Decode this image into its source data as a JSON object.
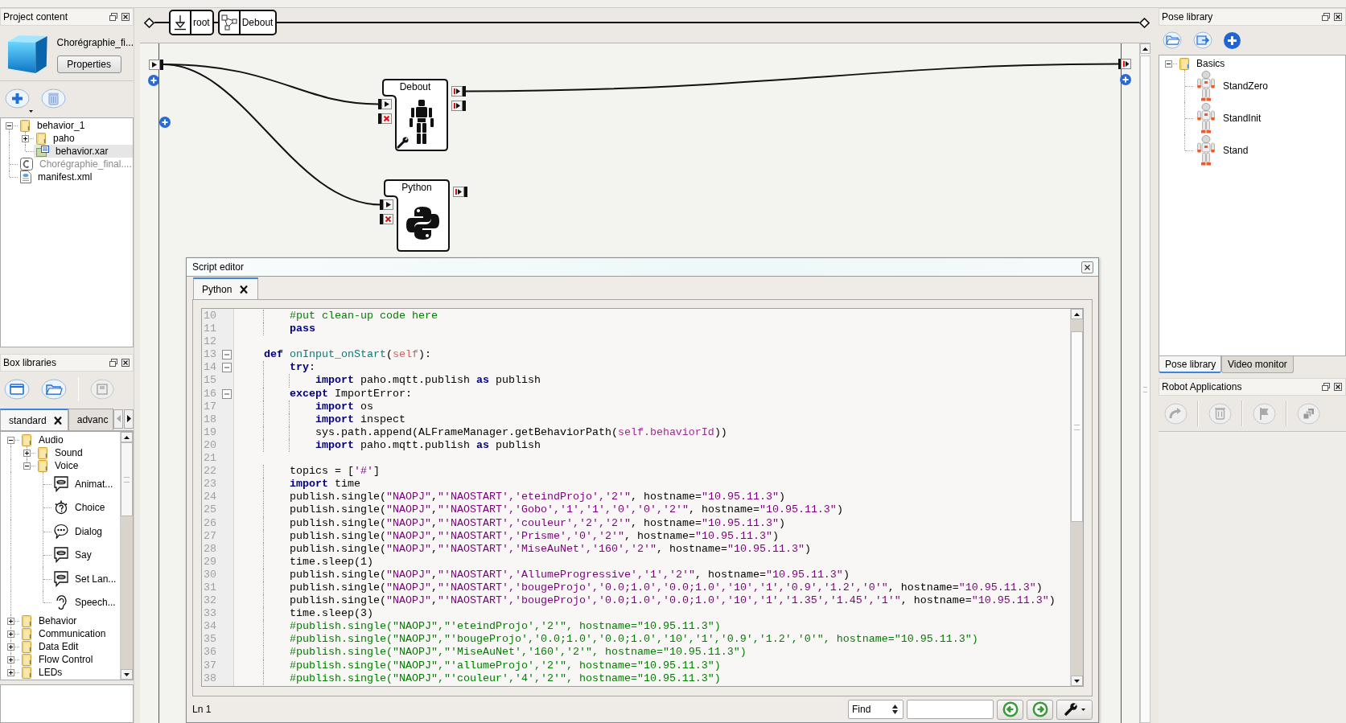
{
  "project_panel": {
    "title": "Project content",
    "project_name": "Chorégraphie_fi...",
    "properties_button": "Properties",
    "tree": [
      {
        "label": "behavior_1",
        "kind": "folder",
        "expanded": true,
        "selected": false,
        "disabled": false,
        "children": [
          {
            "label": "paho",
            "kind": "folder",
            "expanded": false,
            "selected": false,
            "disabled": false
          },
          {
            "label": "behavior.xar",
            "kind": "behavior",
            "expanded": false,
            "selected": true,
            "disabled": false
          }
        ]
      },
      {
        "label": "Chorégraphie_final....",
        "kind": "project",
        "expanded": false,
        "selected": false,
        "disabled": true
      },
      {
        "label": "manifest.xml",
        "kind": "manifest",
        "expanded": false,
        "selected": false,
        "disabled": false
      }
    ]
  },
  "box_libraries": {
    "title": "Box libraries",
    "tabs": [
      {
        "label": "standard",
        "selected": true
      },
      {
        "label": "advanc",
        "selected": false
      }
    ],
    "tree": [
      {
        "label": "Audio",
        "kind": "folder",
        "expanded": true,
        "selected": false,
        "children": [
          {
            "label": "Sound",
            "kind": "folder",
            "expanded": false,
            "selected": false
          },
          {
            "label": "Voice",
            "kind": "folder",
            "expanded": true,
            "selected": false,
            "children": [
              {
                "label": "Animat...",
                "kind": "bubble",
                "expanded": false,
                "selected": false
              },
              {
                "label": "Choice",
                "kind": "choice",
                "expanded": false,
                "selected": false
              },
              {
                "label": "Dialog",
                "kind": "dialog",
                "expanded": false,
                "selected": false
              },
              {
                "label": "Say",
                "kind": "bubble",
                "expanded": false,
                "selected": false
              },
              {
                "label": "Set Lan...",
                "kind": "bubble",
                "expanded": false,
                "selected": false
              },
              {
                "label": "Speech...",
                "kind": "ear",
                "expanded": false,
                "selected": false
              }
            ]
          }
        ]
      },
      {
        "label": "Behavior",
        "kind": "folder",
        "expanded": false,
        "selected": false
      },
      {
        "label": "Communication",
        "kind": "folder",
        "expanded": false,
        "selected": false
      },
      {
        "label": "Data Edit",
        "kind": "folder",
        "expanded": false,
        "selected": false
      },
      {
        "label": "Flow Control",
        "kind": "folder",
        "expanded": false,
        "selected": false
      },
      {
        "label": "LEDs",
        "kind": "folder",
        "expanded": false,
        "selected": false
      }
    ]
  },
  "behavior_path": [
    {
      "label": "root",
      "kind": "root"
    },
    {
      "label": "Debout",
      "kind": "diagram"
    }
  ],
  "boxes": [
    {
      "title": "Debout",
      "kind": "robot"
    },
    {
      "title": "Python",
      "kind": "python"
    }
  ],
  "script_editor": {
    "title": "Script editor",
    "tabs": [
      {
        "label": "Python",
        "selected": true
      }
    ],
    "lines": [
      {
        "number": "10",
        "foldable": false,
        "tokens": [
          {
            "kind": "comment",
            "text": "        #put clean-up code here"
          }
        ]
      },
      {
        "number": "11",
        "foldable": false,
        "tokens": [
          {
            "kind": "keyword",
            "text": "        pass"
          }
        ]
      },
      {
        "number": "12",
        "foldable": false
      },
      {
        "number": "13",
        "foldable": true,
        "tokens": [
          {
            "kind": "keyword",
            "text": "    def"
          },
          {
            "kind": "function",
            "text": " onInput_onStart"
          },
          {
            "kind": "plain",
            "text": "("
          },
          {
            "kind": "self",
            "text": "self"
          },
          {
            "kind": "plain",
            "text": "):"
          }
        ]
      },
      {
        "number": "14",
        "foldable": true,
        "tokens": [
          {
            "kind": "keyword",
            "text": "        try"
          },
          {
            "kind": "plain",
            "text": ":"
          }
        ]
      },
      {
        "number": "15",
        "foldable": false,
        "tokens": [
          {
            "kind": "keyword",
            "text": "            import"
          },
          {
            "kind": "plain",
            "text": " paho.mqtt.publish "
          },
          {
            "kind": "keyword",
            "text": "as"
          },
          {
            "kind": "plain",
            "text": " publish"
          }
        ]
      },
      {
        "number": "16",
        "foldable": true,
        "tokens": [
          {
            "kind": "keyword",
            "text": "        except"
          },
          {
            "kind": "plain",
            "text": " ImportError:"
          }
        ]
      },
      {
        "number": "17",
        "foldable": false,
        "tokens": [
          {
            "kind": "keyword",
            "text": "            import"
          },
          {
            "kind": "plain",
            "text": " os"
          }
        ]
      },
      {
        "number": "18",
        "foldable": false,
        "tokens": [
          {
            "kind": "keyword",
            "text": "            import"
          },
          {
            "kind": "plain",
            "text": " inspect"
          }
        ]
      },
      {
        "number": "19",
        "foldable": false,
        "tokens": [
          {
            "kind": "plain",
            "text": "            sys.path.append(ALFrameManager.getBehaviorPath("
          },
          {
            "kind": "member",
            "text": "self.behaviorId"
          },
          {
            "kind": "plain",
            "text": "))"
          }
        ]
      },
      {
        "number": "20",
        "foldable": false,
        "tokens": [
          {
            "kind": "keyword",
            "text": "            import"
          },
          {
            "kind": "plain",
            "text": " paho.mqtt.publish "
          },
          {
            "kind": "keyword",
            "text": "as"
          },
          {
            "kind": "plain",
            "text": " publish"
          }
        ]
      },
      {
        "number": "21",
        "foldable": false
      },
      {
        "number": "22",
        "foldable": false,
        "tokens": [
          {
            "kind": "plain",
            "text": "        topics = ["
          },
          {
            "kind": "string",
            "text": "'#'"
          },
          {
            "kind": "plain",
            "text": "]"
          }
        ]
      },
      {
        "number": "23",
        "foldable": false,
        "tokens": [
          {
            "kind": "keyword",
            "text": "        import"
          },
          {
            "kind": "plain",
            "text": " time"
          }
        ]
      },
      {
        "number": "24",
        "foldable": false,
        "tokens": [
          {
            "kind": "plain",
            "text": "        publish.single("
          },
          {
            "kind": "string",
            "text": "\"NAOPJ\""
          },
          {
            "kind": "plain",
            "text": ","
          },
          {
            "kind": "string",
            "text": "\"'NAOSTART','eteindProjo','2'\""
          },
          {
            "kind": "plain",
            "text": ", hostname="
          },
          {
            "kind": "string",
            "text": "\"10.95.11.3\""
          },
          {
            "kind": "plain",
            "text": ")"
          }
        ]
      },
      {
        "number": "25",
        "foldable": false,
        "tokens": [
          {
            "kind": "plain",
            "text": "        publish.single("
          },
          {
            "kind": "string",
            "text": "\"NAOPJ\""
          },
          {
            "kind": "plain",
            "text": ","
          },
          {
            "kind": "string",
            "text": "\"'NAOSTART','Gobo','1','1','0','0','2'\""
          },
          {
            "kind": "plain",
            "text": ", hostname="
          },
          {
            "kind": "string",
            "text": "\"10.95.11.3\""
          },
          {
            "kind": "plain",
            "text": ")"
          }
        ]
      },
      {
        "number": "26",
        "foldable": false,
        "tokens": [
          {
            "kind": "plain",
            "text": "        publish.single("
          },
          {
            "kind": "string",
            "text": "\"NAOPJ\""
          },
          {
            "kind": "plain",
            "text": ","
          },
          {
            "kind": "string",
            "text": "\"'NAOSTART','couleur','2','2'\""
          },
          {
            "kind": "plain",
            "text": ", hostname="
          },
          {
            "kind": "string",
            "text": "\"10.95.11.3\""
          },
          {
            "kind": "plain",
            "text": ")"
          }
        ]
      },
      {
        "number": "27",
        "foldable": false,
        "tokens": [
          {
            "kind": "plain",
            "text": "        publish.single("
          },
          {
            "kind": "string",
            "text": "\"NAOPJ\""
          },
          {
            "kind": "plain",
            "text": ","
          },
          {
            "kind": "string",
            "text": "\"'NAOSTART','Prisme','0','2'\""
          },
          {
            "kind": "plain",
            "text": ", hostname="
          },
          {
            "kind": "string",
            "text": "\"10.95.11.3\""
          },
          {
            "kind": "plain",
            "text": ")"
          }
        ]
      },
      {
        "number": "28",
        "foldable": false,
        "tokens": [
          {
            "kind": "plain",
            "text": "        publish.single("
          },
          {
            "kind": "string",
            "text": "\"NAOPJ\""
          },
          {
            "kind": "plain",
            "text": ","
          },
          {
            "kind": "string",
            "text": "\"'NAOSTART','MiseAuNet','160','2'\""
          },
          {
            "kind": "plain",
            "text": ", hostname="
          },
          {
            "kind": "string",
            "text": "\"10.95.11.3\""
          },
          {
            "kind": "plain",
            "text": ")"
          }
        ]
      },
      {
        "number": "29",
        "foldable": false,
        "tokens": [
          {
            "kind": "plain",
            "text": "        time.sleep(1)"
          }
        ]
      },
      {
        "number": "30",
        "foldable": false,
        "tokens": [
          {
            "kind": "plain",
            "text": "        publish.single("
          },
          {
            "kind": "string",
            "text": "\"NAOPJ\""
          },
          {
            "kind": "plain",
            "text": ","
          },
          {
            "kind": "string",
            "text": "\"'NAOSTART','AllumeProgressive','1','2'\""
          },
          {
            "kind": "plain",
            "text": ", hostname="
          },
          {
            "kind": "string",
            "text": "\"10.95.11.3\""
          },
          {
            "kind": "plain",
            "text": ")"
          }
        ]
      },
      {
        "number": "31",
        "foldable": false,
        "tokens": [
          {
            "kind": "plain",
            "text": "        publish.single("
          },
          {
            "kind": "string",
            "text": "\"NAOPJ\""
          },
          {
            "kind": "plain",
            "text": ","
          },
          {
            "kind": "string",
            "text": "\"'NAOSTART','bougeProjo','0.0;1.0','0.0;1.0','10','1','0.9','1.2','0'\""
          },
          {
            "kind": "plain",
            "text": ", hostname="
          },
          {
            "kind": "string",
            "text": "\"10.95.11.3\""
          },
          {
            "kind": "plain",
            "text": ")"
          }
        ]
      },
      {
        "number": "32",
        "foldable": false,
        "tokens": [
          {
            "kind": "plain",
            "text": "        publish.single("
          },
          {
            "kind": "string",
            "text": "\"NAOPJ\""
          },
          {
            "kind": "plain",
            "text": ","
          },
          {
            "kind": "string",
            "text": "\"'NAOSTART','bougeProjo','0.0;1.0','0.0;1.0','10','1','1.35','1.45','1'\""
          },
          {
            "kind": "plain",
            "text": ", hostname="
          },
          {
            "kind": "string",
            "text": "\"10.95.11.3\""
          },
          {
            "kind": "plain",
            "text": ")"
          }
        ]
      },
      {
        "number": "33",
        "foldable": false,
        "tokens": [
          {
            "kind": "plain",
            "text": "        time.sleep(3)"
          }
        ]
      },
      {
        "number": "34",
        "foldable": false,
        "tokens": [
          {
            "kind": "comment",
            "text": "        #publish.single(\"NAOPJ\",\"'eteindProjo','2'\", hostname=\"10.95.11.3\")"
          }
        ]
      },
      {
        "number": "35",
        "foldable": false,
        "tokens": [
          {
            "kind": "comment",
            "text": "        #publish.single(\"NAOPJ\",\"'bougeProjo','0.0;1.0','0.0;1.0','10','1','0.9','1.2','0'\", hostname=\"10.95.11.3\")"
          }
        ]
      },
      {
        "number": "36",
        "foldable": false,
        "tokens": [
          {
            "kind": "comment",
            "text": "        #publish.single(\"NAOPJ\",\"'MiseAuNet','160','2'\", hostname=\"10.95.11.3\")"
          }
        ]
      },
      {
        "number": "37",
        "foldable": false,
        "tokens": [
          {
            "kind": "comment",
            "text": "        #publish.single(\"NAOPJ\",\"'allumeProjo','2'\", hostname=\"10.95.11.3\")"
          }
        ]
      },
      {
        "number": "38",
        "foldable": false,
        "tokens": [
          {
            "kind": "comment",
            "text": "        #publish.single(\"NAOPJ\",\"'couleur','4','2'\", hostname=\"10.95.11.3\")"
          }
        ]
      }
    ],
    "status": "Ln 1",
    "find_mode": "Find"
  },
  "pose_library": {
    "title": "Pose library",
    "tree": [
      {
        "label": "Basics",
        "kind": "folder",
        "expanded": true,
        "selected": false,
        "children": [
          {
            "label": "StandZero",
            "kind": "pose",
            "expanded": false,
            "selected": false
          },
          {
            "label": "StandInit",
            "kind": "pose",
            "expanded": false,
            "selected": false
          },
          {
            "label": "Stand",
            "kind": "pose",
            "expanded": false,
            "selected": false
          }
        ]
      }
    ],
    "tabs": [
      {
        "label": "Pose library",
        "selected": true
      },
      {
        "label": "Video monitor",
        "selected": false
      }
    ]
  },
  "robot_applications": {
    "title": "Robot Applications"
  }
}
